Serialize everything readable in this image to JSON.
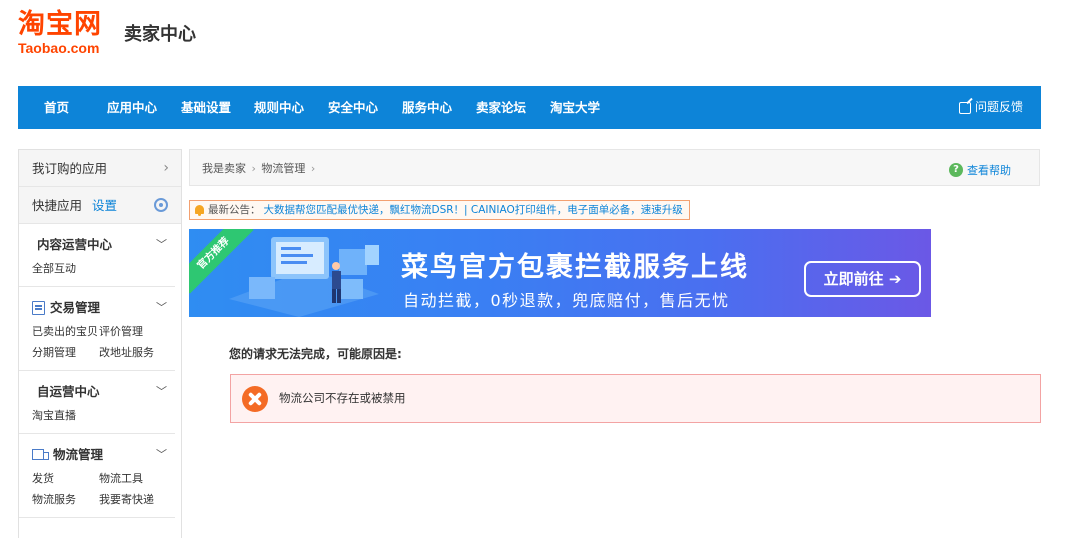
{
  "header": {
    "logo_cn": "淘宝网",
    "logo_en": "Taobao.com",
    "title": "卖家中心"
  },
  "nav": {
    "items": [
      "首页",
      "应用中心",
      "基础设置",
      "规则中心",
      "安全中心",
      "服务中心",
      "卖家论坛",
      "淘宝大学"
    ],
    "feedback": "问题反馈"
  },
  "sidebar": {
    "subscribed_apps": "我订购的应用",
    "quick_apps": "快捷应用",
    "settings_link": "设置",
    "groups": [
      {
        "title": "内容运营中心",
        "links": [
          "全部互动"
        ]
      },
      {
        "title": "交易管理",
        "links": [
          "已卖出的宝贝",
          "评价管理",
          "分期管理",
          "改地址服务"
        ]
      },
      {
        "title": "自运营中心",
        "links": [
          "淘宝直播"
        ]
      },
      {
        "title": "物流管理",
        "links": [
          "发货",
          "物流工具",
          "物流服务",
          "我要寄快递"
        ]
      }
    ]
  },
  "breadcrumb": {
    "items": [
      "我是卖家",
      "物流管理"
    ],
    "sep": "›",
    "help": "查看帮助"
  },
  "notice": {
    "label": "最新公告：",
    "text": "大数据帮您匹配最优快递，飘红物流DSR！| CAINIAO打印组件，电子面单必备，速速升级"
  },
  "banner": {
    "ribbon": "官方推荐",
    "title": "菜鸟官方包裹拦截服务上线",
    "subtitle": "自动拦截，0秒退款，兜底赔付，售后无忧",
    "button": "立即前往 ➔"
  },
  "error": {
    "heading": "您的请求无法完成，可能原因是:",
    "message": "物流公司不存在或被禁用"
  },
  "colors": {
    "nav_bg": "#0d84d8",
    "logo": "#ff4400",
    "error_icon": "#f46b25"
  }
}
